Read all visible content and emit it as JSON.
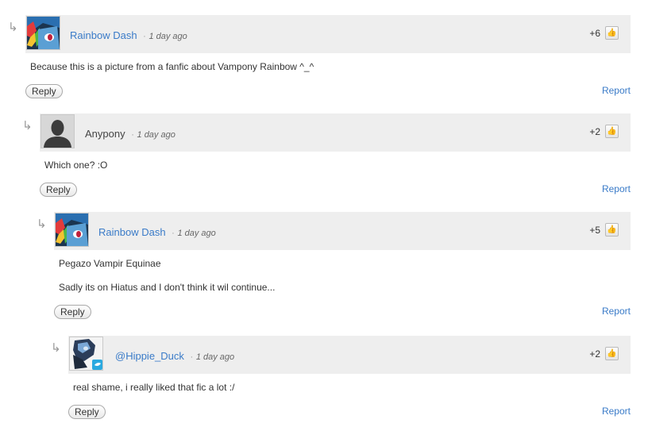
{
  "comments": [
    {
      "author": "Rainbow Dash",
      "separator": "·",
      "time": "1 day ago",
      "score": "+6",
      "lines": [
        "Because this is a picture from a fanfic about Vampony Rainbow ^_^"
      ],
      "reply_label": "Reply",
      "report_label": "Report",
      "avatar": "rainbow-dash-avatar"
    },
    {
      "author": "Anypony",
      "separator": "·",
      "time": "1 day ago",
      "score": "+2",
      "lines": [
        "Which one? :O"
      ],
      "reply_label": "Reply",
      "report_label": "Report",
      "avatar": "default-silhouette-avatar"
    },
    {
      "author": "Rainbow Dash",
      "separator": "·",
      "time": "1 day ago",
      "score": "+5",
      "lines": [
        "Pegazo Vampir Equinae",
        "Sadly its on Hiatus and I don't think it wil continue..."
      ],
      "reply_label": "Reply",
      "report_label": "Report",
      "avatar": "rainbow-dash-avatar"
    },
    {
      "author": "@Hippie_Duck",
      "separator": "·",
      "time": "1 day ago",
      "score": "+2",
      "lines": [
        "real shame, i really liked that fic a lot :/"
      ],
      "reply_label": "Reply",
      "report_label": "Report",
      "avatar": "twitter-pony-avatar"
    }
  ],
  "icons": {
    "reply_arrow": "↳",
    "like": "👍"
  },
  "colors": {
    "link": "#3a7bc8",
    "header_bg": "#eeeeee"
  }
}
